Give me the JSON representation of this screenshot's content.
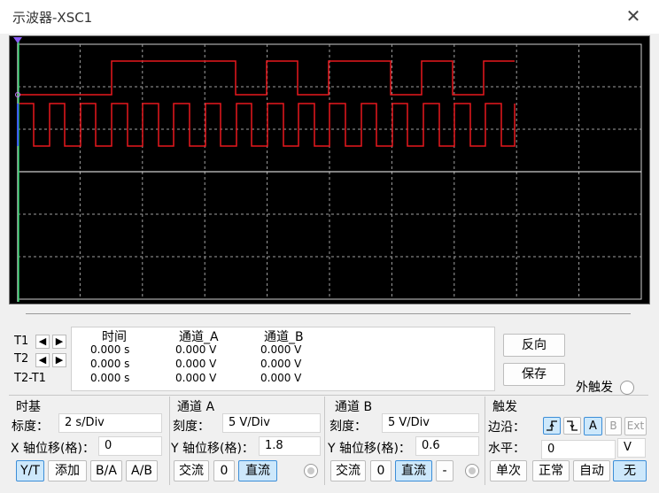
{
  "window": {
    "title": "示波器-XSC1",
    "close_icon": "close-icon"
  },
  "colors": {
    "trace": "#e8181e",
    "grid": "#b0b0b0",
    "screen": "#000000",
    "cursor1": "#e0e0e0",
    "cursor2": "#22c55e",
    "cursor_marker": "#8a5cf6",
    "selected": "#cde8fb"
  },
  "readout": {
    "rows": [
      {
        "label": "T1",
        "time": "0.000 s",
        "ch_a": "0.000 V",
        "ch_b": "0.000 V"
      },
      {
        "label": "T2",
        "time": "0.000 s",
        "ch_a": "0.000 V",
        "ch_b": "0.000 V"
      },
      {
        "label": "T2-T1",
        "time": "0.000 s",
        "ch_a": "0.000 V",
        "ch_b": "0.000 V"
      }
    ],
    "headers": {
      "time": "时间",
      "ch_a": "通道_A",
      "ch_b": "通道_B"
    },
    "reverse_label": "反向",
    "save_label": "保存",
    "ext_trigger_label": "外触发"
  },
  "timebase": {
    "title": "时基",
    "scale_label": "标度：",
    "scale_value": "2  s/Div",
    "xpos_label": "X 轴位移(格)：",
    "xpos_value": "0",
    "buttons": {
      "yt": "Y/T",
      "add": "添加",
      "ba": "B/A",
      "ab": "A/B"
    }
  },
  "channel_a": {
    "title": "通道 A",
    "scale_label": "刻度：",
    "scale_value": "5  V/Div",
    "ypos_label": "Y 轴位移(格)：",
    "ypos_value": "1.8",
    "ac": "交流",
    "zero": "0",
    "dc": "直流"
  },
  "channel_b": {
    "title": "通道 B",
    "scale_label": "刻度：",
    "scale_value": "5  V/Div",
    "ypos_label": "Y 轴位移(格)：",
    "ypos_value": "0.6",
    "ac": "交流",
    "zero": "0",
    "dc": "直流",
    "minus": "-"
  },
  "trigger": {
    "title": "触发",
    "edge_label": "边沿：",
    "level_label": "水平：",
    "level_value": "0",
    "level_unit": "V",
    "source_a": "A",
    "source_b": "B",
    "source_ext": "Ext",
    "single": "单次",
    "normal": "正常",
    "auto": "自动",
    "none": "无"
  }
}
